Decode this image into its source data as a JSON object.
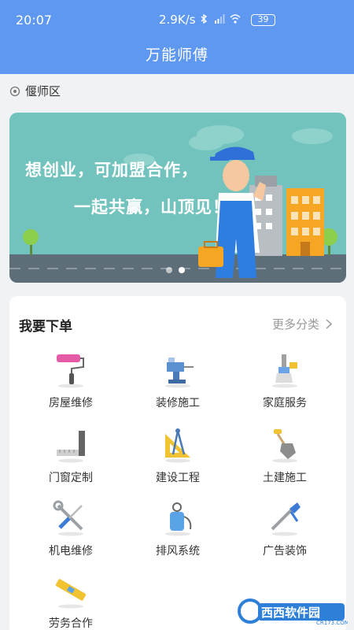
{
  "status_bar": {
    "time": "20:07",
    "network_speed": "2.9K/s",
    "battery": "39"
  },
  "header": {
    "title": "万能师傅"
  },
  "location": {
    "icon": "location-pin-icon",
    "label": "偃师区"
  },
  "banner": {
    "line1": "想创业，可加盟合作，",
    "line2": "一起共赢，山顶见！",
    "slide_count": 2,
    "active_slide": 1
  },
  "order_section": {
    "title": "我要下单",
    "more_label": "更多分类",
    "categories": [
      {
        "label": "房屋维修",
        "icon": "paint-roller-icon"
      },
      {
        "label": "装修施工",
        "icon": "bench-vise-icon"
      },
      {
        "label": "家庭服务",
        "icon": "cleaning-brush-icon"
      },
      {
        "label": "门窗定制",
        "icon": "square-ruler-icon"
      },
      {
        "label": "建设工程",
        "icon": "compass-triangle-icon"
      },
      {
        "label": "土建施工",
        "icon": "shovel-icon"
      },
      {
        "label": "机电维修",
        "icon": "wrench-screwdriver-icon"
      },
      {
        "label": "排风系统",
        "icon": "sprayer-tank-icon"
      },
      {
        "label": "广告装饰",
        "icon": "caulking-gun-icon"
      },
      {
        "label": "劳务合作",
        "icon": "spirit-level-icon"
      }
    ]
  },
  "watermark": {
    "brand": "西西软件园",
    "site": "CR173.COM"
  }
}
